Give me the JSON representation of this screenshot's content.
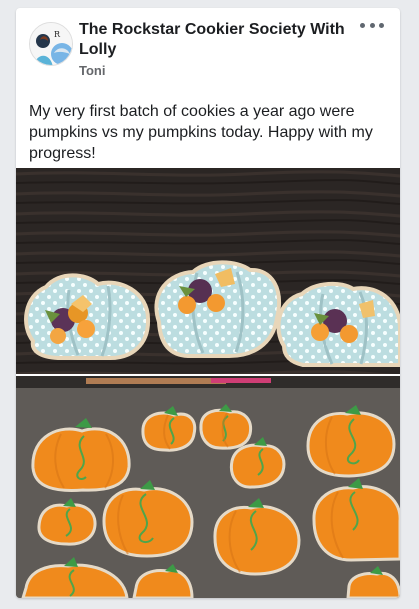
{
  "post": {
    "group_name": "The Rockstar Cookier Society With Lolly",
    "author": "Toni",
    "text": "My very first batch of cookies a year ago were pumpkins vs my pumpkins today.  Happy with my progress!"
  },
  "icons": {
    "more": "more-options-icon",
    "avatar": "group-avatar"
  },
  "colors": {
    "cookie_blue": "#bcdde0",
    "cookie_orange": "#f08a1c",
    "stem_green": "#3d9a46"
  }
}
